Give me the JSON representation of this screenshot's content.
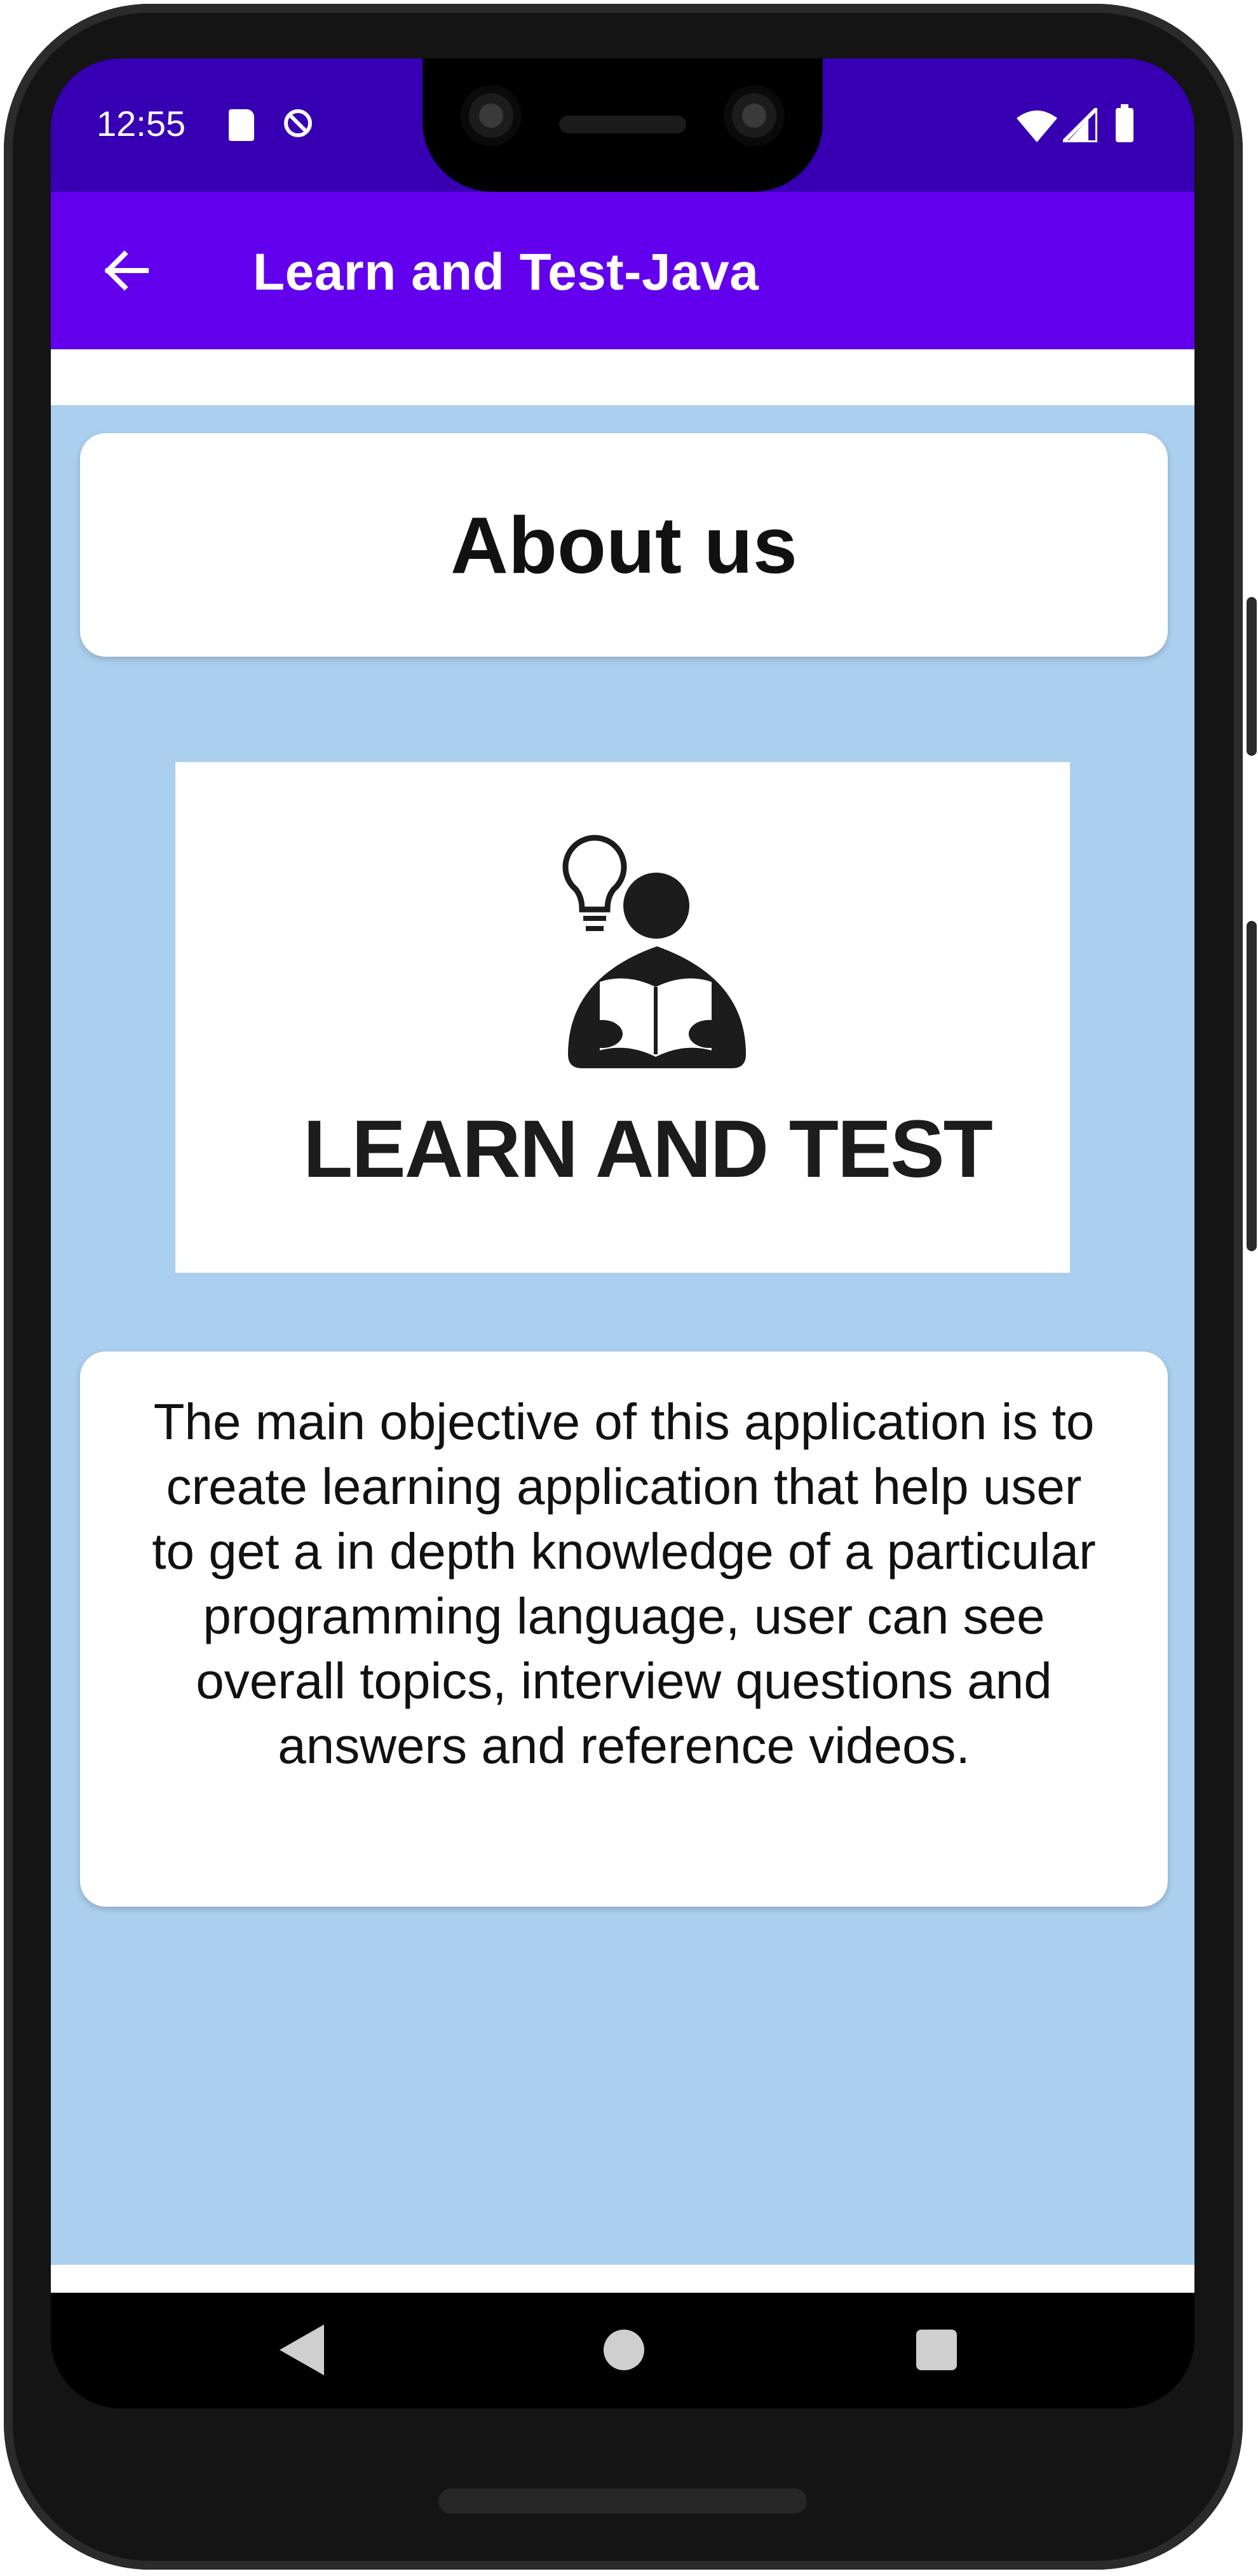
{
  "status_bar": {
    "time": "12:55",
    "icons": [
      "sd-card-icon",
      "sync-disabled-icon",
      "wifi-icon",
      "signal-icon",
      "battery-icon"
    ]
  },
  "app_bar": {
    "title": "Learn and Test-Java",
    "back_icon": "arrow-back-icon"
  },
  "page": {
    "heading": "About us",
    "logo": {
      "text": "LEARN AND TEST",
      "icon": "person-reading-lightbulb-icon"
    },
    "description": "The main objective of this application is to create learning application that help user to get a in depth knowledge of a particular programming language, user can see overall topics, interview questions and answers and reference videos."
  },
  "nav_bar": {
    "icons": [
      "nav-back-icon",
      "nav-home-icon",
      "nav-recents-icon"
    ]
  },
  "colors": {
    "status_bar": "#3700b3",
    "app_bar": "#6200ee",
    "content_background": "#abcfee",
    "card": "#ffffff"
  }
}
